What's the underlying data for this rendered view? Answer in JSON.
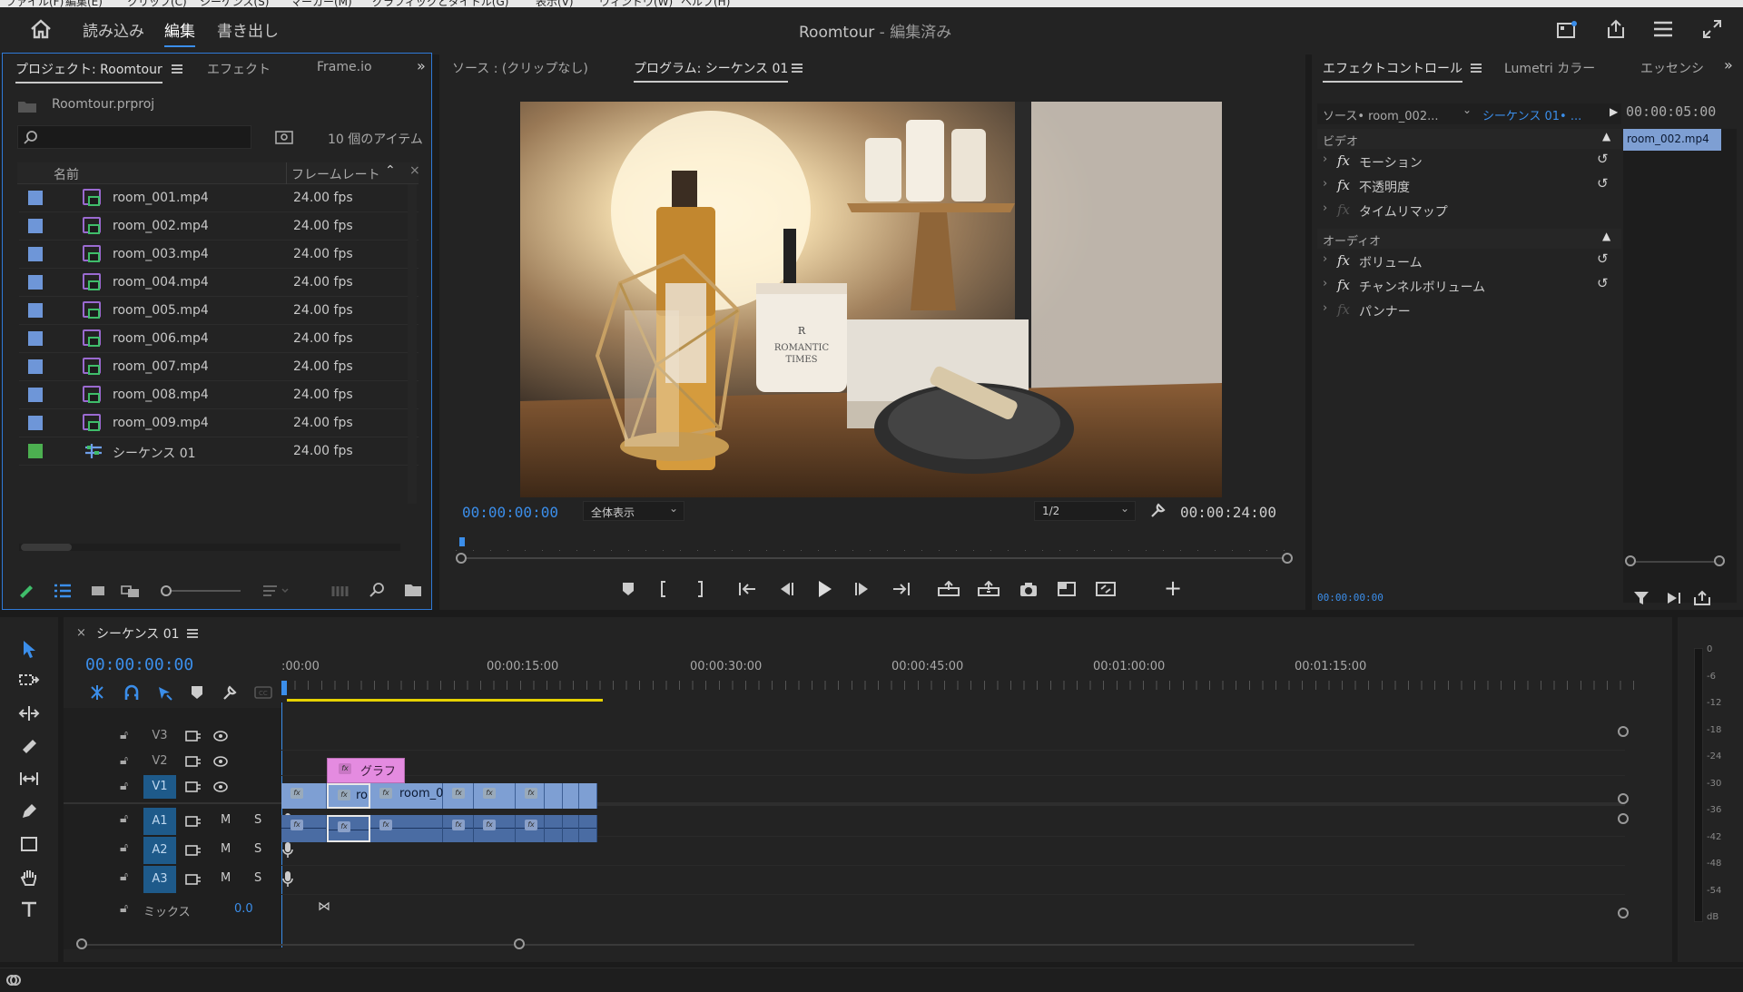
{
  "menubar": {
    "items": [
      "ファイル(F)",
      "編集(E)",
      "クリップ(C)",
      "シーケンス(S)",
      "マーカー(M)",
      "グラフィックとタイトル(G)",
      "表示(V)",
      "ウィンドウ(W)",
      "ヘルプ(H)"
    ]
  },
  "header": {
    "workspaces": [
      "読み込み",
      "編集",
      "書き出し"
    ],
    "active_workspace": "編集",
    "title_project": "Roomtour",
    "title_sep": " - ",
    "title_state": "編集済み"
  },
  "project_panel": {
    "tabs": [
      "プロジェクト: Roomtour",
      "エフェクト",
      "Frame.io"
    ],
    "file_name": "Roomtour.prproj",
    "search_placeholder": "",
    "item_count": "10 個のアイテム",
    "col_name": "名前",
    "col_fps": "フレームレート",
    "items": [
      {
        "name": "room_001.mp4",
        "fps": "24.00 fps",
        "color": "#6e96d8",
        "kind": "clip"
      },
      {
        "name": "room_002.mp4",
        "fps": "24.00 fps",
        "color": "#6e96d8",
        "kind": "clip"
      },
      {
        "name": "room_003.mp4",
        "fps": "24.00 fps",
        "color": "#6e96d8",
        "kind": "clip"
      },
      {
        "name": "room_004.mp4",
        "fps": "24.00 fps",
        "color": "#6e96d8",
        "kind": "clip"
      },
      {
        "name": "room_005.mp4",
        "fps": "24.00 fps",
        "color": "#6e96d8",
        "kind": "clip"
      },
      {
        "name": "room_006.mp4",
        "fps": "24.00 fps",
        "color": "#6e96d8",
        "kind": "clip"
      },
      {
        "name": "room_007.mp4",
        "fps": "24.00 fps",
        "color": "#6e96d8",
        "kind": "clip"
      },
      {
        "name": "room_008.mp4",
        "fps": "24.00 fps",
        "color": "#6e96d8",
        "kind": "clip"
      },
      {
        "name": "room_009.mp4",
        "fps": "24.00 fps",
        "color": "#6e96d8",
        "kind": "clip"
      },
      {
        "name": "シーケンス 01",
        "fps": "24.00 fps",
        "color": "#4caf50",
        "kind": "sequence"
      }
    ]
  },
  "monitor": {
    "source_tab": "ソース : (クリップなし)",
    "program_tab": "プログラム: シーケンス 01",
    "video_text_logo": "R",
    "video_text_line1": "ROMANTIC",
    "video_text_line2": "TIMES",
    "current_tc": "00:00:00:00",
    "fit_select": "全体表示",
    "resolution_select": "1/2",
    "duration_tc": "00:00:24:00"
  },
  "effect_controls": {
    "tabs": [
      "エフェクトコントロール",
      "Lumetri カラー",
      "エッセンシ"
    ],
    "source_label": "ソース• room_002...",
    "sequence_label": "シーケンス 01• ...",
    "tc_right": "00:00:05:00",
    "clip_chip": "room_002.mp4",
    "video_section": "ビデオ",
    "audio_section": "オーディオ",
    "video_effects": [
      "モーション",
      "不透明度",
      "タイムリマップ"
    ],
    "audio_effects": [
      "ボリューム",
      "チャンネルボリューム",
      "パンナー"
    ],
    "bottom_tc": "00:00:00:00"
  },
  "timeline": {
    "tab": "シーケンス 01",
    "current_tc": "00:00:00:00",
    "ruler": [
      ":00:00",
      "00:00:15:00",
      "00:00:30:00",
      "00:00:45:00",
      "00:01:00:00",
      "00:01:15:00"
    ],
    "tracks": [
      "V3",
      "V2",
      "V1",
      "A1",
      "A2",
      "A3"
    ],
    "mute_label": "M",
    "solo_label": "S",
    "mix_label": "ミックス",
    "mix_value": "0.0",
    "graphic_clip": "グラフ",
    "v1_clip_a": "ro",
    "v1_clip_b": "room_0",
    "fx_label": "fx"
  },
  "meter": {
    "labels": [
      "0",
      "-6",
      "-12",
      "-18",
      "-24",
      "-30",
      "-36",
      "-42",
      "-48",
      "-54",
      "dB"
    ]
  },
  "colors": {
    "accent": "#3b8eea",
    "clip_video": "#7e9fd3",
    "clip_audio": "#4a6ca3",
    "graphic_clip": "#e48be0",
    "playhead_bar": "#e6d200"
  }
}
